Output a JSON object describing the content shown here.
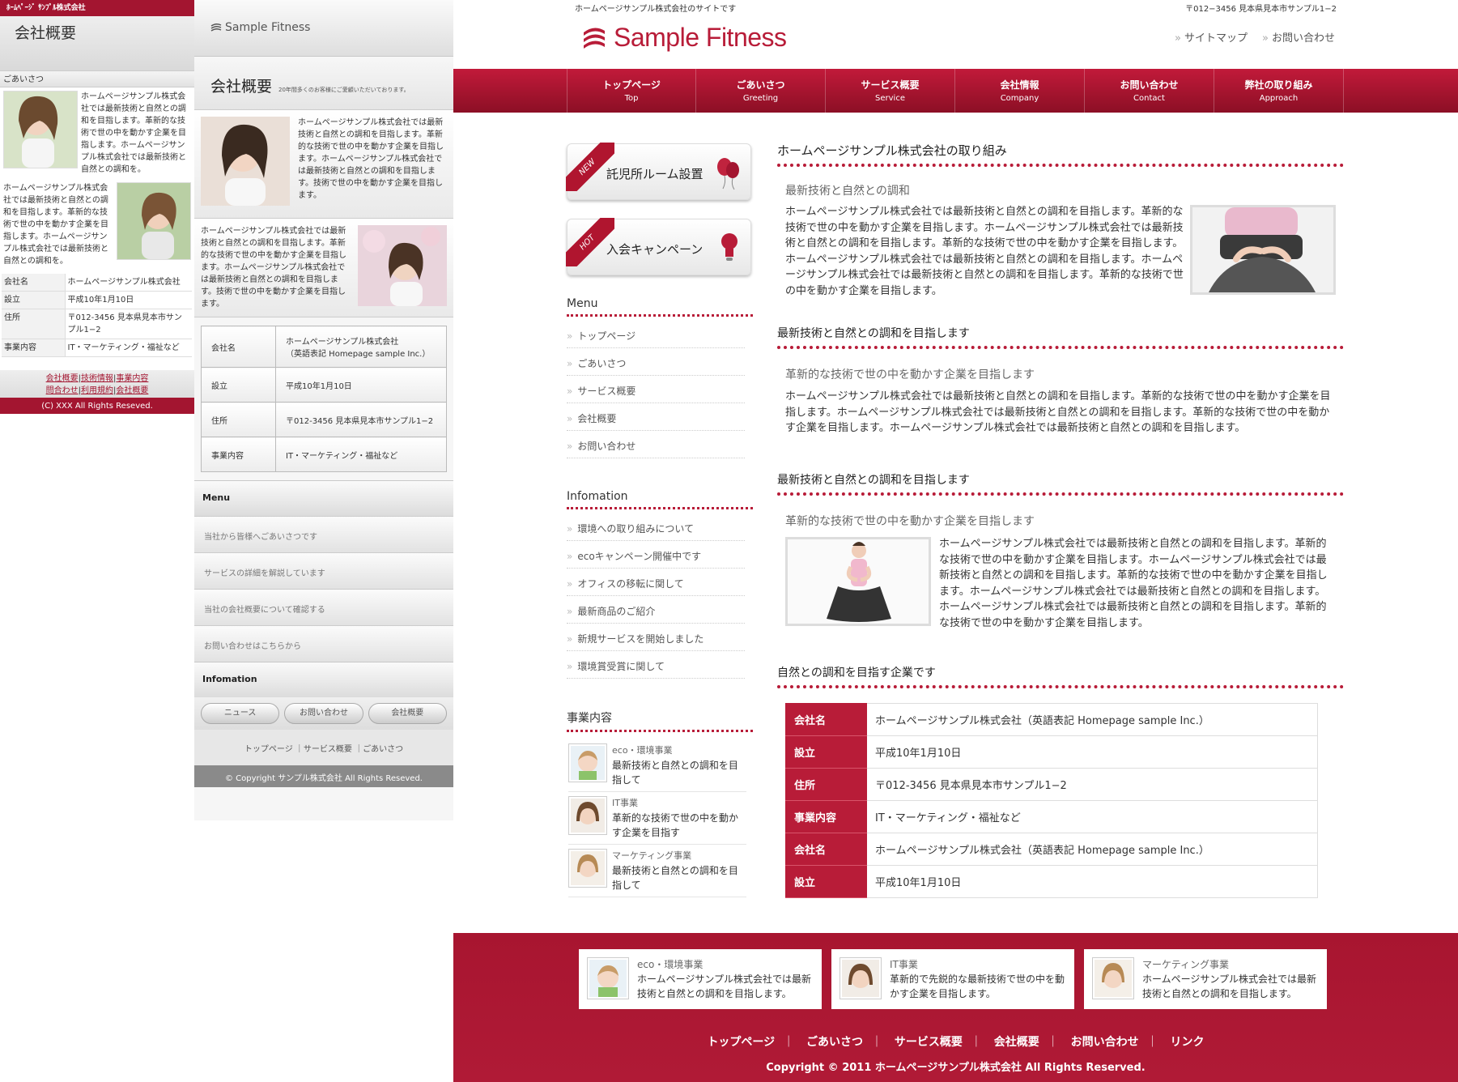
{
  "mobile": {
    "company_header": "ﾎｰﾑﾍﾟｰｼﾞ ｻﾝﾌﾟﾙ株式会社",
    "page_title": "会社概要",
    "greeting_heading": "ごあいさつ",
    "paragraph1": "ホームページサンプル株式会社では最新技術と自然との調和を目指します。革新的な技術で世の中を動かす企業を目指します。ホームページサンプル株式会社では最新技術と自然との調和を。",
    "paragraph2": "ホームページサンプル株式会社では最新技術と自然との調和を目指します。革新的な技術で世の中を動かす企業を目指します。ホームページサンプル株式会社では最新技術と自然との調和を。",
    "table": [
      {
        "label": "会社名",
        "value": "ホームページサンプル株式会社"
      },
      {
        "label": "設立",
        "value": "平成10年1月10日"
      },
      {
        "label": "住所",
        "value": "〒012-3456 見本県見本市サンプル1−2"
      },
      {
        "label": "事業内容",
        "value": "IT・マーケティング・福祉など"
      }
    ],
    "links": [
      "会社概要",
      "技術情報",
      "事業内容",
      "問合わせ",
      "利用規約",
      "会社概要"
    ],
    "copyright": "(C) XXX All Rights Reseved."
  },
  "smartphone": {
    "logo": "Sample Fitness",
    "page_title": "会社概要",
    "page_subtitle": "20年間多くのお客様にご愛顧いただいております。",
    "paragraph1": "ホームページサンプル株式会社では最新技術と自然との調和を目指します。革新的な技術で世の中を動かす企業を目指します。ホームページサンプル株式会社では最新技術と自然との調和を目指します。技術で世の中を動かす企業を目指します。",
    "paragraph2": "ホームページサンプル株式会社では最新技術と自然との調和を目指します。革新的な技術で世の中を動かす企業を目指します。ホームページサンプル株式会社では最新技術と自然との調和を目指します。技術で世の中を動かす企業を目指します。",
    "table": [
      {
        "label": "会社名",
        "value": "ホームページサンプル株式会社",
        "value2": "（英語表記 Homepage sample Inc.）"
      },
      {
        "label": "設立",
        "value": "平成10年1月10日",
        "value2": ""
      },
      {
        "label": "住所",
        "value": "〒012-3456 見本県見本市サンプル1−2",
        "value2": ""
      },
      {
        "label": "事業内容",
        "value": "IT・マーケティング・福祉など",
        "value2": ""
      }
    ],
    "menu_heading": "Menu",
    "menu_items": [
      "当社から皆様へごあいさつです",
      "サービスの詳細を解説しています",
      "当社の会社概要について確認する",
      "お問い合わせはこちらから"
    ],
    "info_heading": "Infomation",
    "buttons": [
      "ニュース",
      "お問い合わせ",
      "会社概要"
    ],
    "footer_links": "トップページ ｜サービス概要 ｜ごあいさつ",
    "copyright": "© Copyright サンプル株式会社 All Rights Reseved."
  },
  "pc": {
    "tagline": "ホームページサンプル株式会社のサイトです",
    "address": "〒012−3456 見本県見本市サンプル1−2",
    "logo": "Sample Fitness",
    "util_links": [
      "サイトマップ",
      "お問い合わせ"
    ],
    "nav": [
      {
        "ja": "トップページ",
        "en": "Top"
      },
      {
        "ja": "ごあいさつ",
        "en": "Greeting"
      },
      {
        "ja": "サービス概要",
        "en": "Service"
      },
      {
        "ja": "会社情報",
        "en": "Company"
      },
      {
        "ja": "お問い合わせ",
        "en": "Contact"
      },
      {
        "ja": "弊社の取り組み",
        "en": "Approach"
      }
    ],
    "banners": [
      {
        "ribbon": "NEW",
        "label": "託児所ルーム設置"
      },
      {
        "ribbon": "HOT",
        "label": "入会キャンペーン"
      }
    ],
    "sidebar_menu_heading": "Menu",
    "sidebar_menu": [
      "トップページ",
      "ごあいさつ",
      "サービス概要",
      "会社概要",
      "お問い合わせ"
    ],
    "sidebar_info_heading": "Infomation",
    "sidebar_info": [
      "環境への取り組みについて",
      "ecoキャンペーン開催中です",
      "オフィスの移転に関して",
      "最新商品のご紹介",
      "新規サービスを開始しました",
      "環境賞受賞に関して"
    ],
    "sidebar_biz_heading": "事業内容",
    "sidebar_biz": [
      {
        "title": "eco・環境事業",
        "text": "最新技術と自然との調和を目指して"
      },
      {
        "title": "IT事業",
        "text": "革新的な技術で世の中を動かす企業を目指す"
      },
      {
        "title": "マーケティング事業",
        "text": "最新技術と自然との調和を目指して"
      }
    ],
    "main_title": "ホームページサンプル株式会社の取り組み",
    "s1_sub": "最新技術と自然との調和",
    "s1_text": "ホームページサンプル株式会社では最新技術と自然との調和を目指します。革新的な技術で世の中を動かす企業を目指します。ホームページサンプル株式会社では最新技術と自然との調和を目指します。革新的な技術で世の中を動かす企業を目指します。ホームページサンプル株式会社では最新技術と自然との調和を目指します。ホームページサンプル株式会社では最新技術と自然との調和を目指します。革新的な技術で世の中を動かす企業を目指します。",
    "s2_heading": "最新技術と自然との調和を目指します",
    "s2_sub": "革新的な技術で世の中を動かす企業を目指します",
    "s2_text": "ホームページサンプル株式会社では最新技術と自然との調和を目指します。革新的な技術で世の中を動かす企業を目指します。ホームページサンプル株式会社では最新技術と自然との調和を目指します。革新的な技術で世の中を動かす企業を目指します。ホームページサンプル株式会社では最新技術と自然との調和を目指します。",
    "s3_heading": "最新技術と自然との調和を目指します",
    "s3_sub": "革新的な技術で世の中を動かす企業を目指します",
    "s3_text": "ホームページサンプル株式会社では最新技術と自然との調和を目指します。革新的な技術で世の中を動かす企業を目指します。ホームページサンプル株式会社では最新技術と自然との調和を目指します。革新的な技術で世の中を動かす企業を目指します。ホームページサンプル株式会社では最新技術と自然との調和を目指します。ホームページサンプル株式会社では最新技術と自然との調和を目指します。革新的な技術で世の中を動かす企業を目指します。",
    "s4_heading": "自然との調和を目指す企業です",
    "company_table": [
      {
        "label": "会社名",
        "value": "ホームページサンプル株式会社（英語表記 Homepage sample Inc.）"
      },
      {
        "label": "設立",
        "value": "平成10年1月10日"
      },
      {
        "label": "住所",
        "value": "〒012-3456 見本県見本市サンプル1−2"
      },
      {
        "label": "事業内容",
        "value": "IT・マーケティング・福祉など"
      },
      {
        "label": "会社名",
        "value": "ホームページサンプル株式会社（英語表記 Homepage sample Inc.）"
      },
      {
        "label": "設立",
        "value": "平成10年1月10日"
      }
    ],
    "footer_cards": [
      {
        "title": "eco・環境事業",
        "text": "ホームページサンプル株式会社では最新技術と自然との調和を目指します。"
      },
      {
        "title": "IT事業",
        "text": "革新的で先鋭的な最新技術で世の中を動かす企業を目指します。"
      },
      {
        "title": "マーケティング事業",
        "text": "ホームページサンプル株式会社では最新技術と自然との調和を目指します。"
      }
    ],
    "footer_links": [
      "トップページ",
      "ごあいさつ",
      "サービス概要",
      "会社概要",
      "お問い合わせ",
      "リンク"
    ],
    "copyright": "Copyright © 2011 ホームページサンプル株式会社 All Rights Reserved."
  },
  "colors": {
    "brand_red": "#b81c38",
    "nav_dark": "#8c0f25",
    "gray": "#e5e5e5"
  }
}
